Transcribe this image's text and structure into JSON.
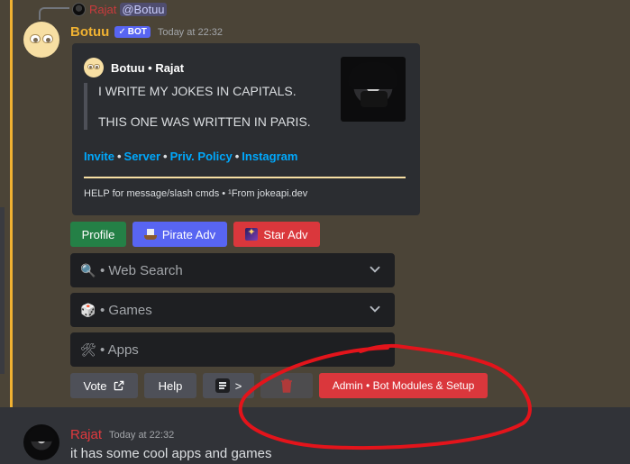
{
  "reply": {
    "username": "Rajat",
    "mention": "@Botuu"
  },
  "bot_message": {
    "username": "Botuu",
    "bot_tag": "BOT",
    "bot_tag_check": "✓",
    "timestamp": "Today at 22:32"
  },
  "embed": {
    "author": "Botuu • Rajat",
    "lines": [
      "I WRITE MY JOKES IN CAPITALS.",
      "THIS ONE WAS WRITTEN IN PARIS."
    ],
    "links": [
      "Invite",
      "Server",
      "Priv. Policy",
      "Instagram"
    ],
    "link_separator": "•",
    "footer": "HELP for message/slash cmds • ¹From jokeapi.dev",
    "accent_color": "#f7dfa3",
    "link_color": "#00a8fc"
  },
  "buttons_row1": {
    "profile": "Profile",
    "pirate": "Pirate Adv",
    "star": "Star Adv"
  },
  "selects": [
    {
      "icon": "🔍",
      "label": "• Web Search"
    },
    {
      "icon": "🎲",
      "label": "• Games"
    },
    {
      "icon": "🛠",
      "label": "• Apps"
    }
  ],
  "buttons_row2": {
    "vote": "Vote",
    "help": "Help",
    "more": ">",
    "admin": "Admin • Bot Modules & Setup"
  },
  "user_message": {
    "username": "Rajat",
    "timestamp": "Today at 22:32",
    "text": "it has some cool apps and games"
  },
  "colors": {
    "mention_bg": "#4b4437",
    "mention_bar": "#f0b232",
    "bot_name": "#f0b232",
    "blurple": "#5865f2",
    "green": "#248046",
    "red": "#da373c",
    "annotation": "#e3141b"
  }
}
